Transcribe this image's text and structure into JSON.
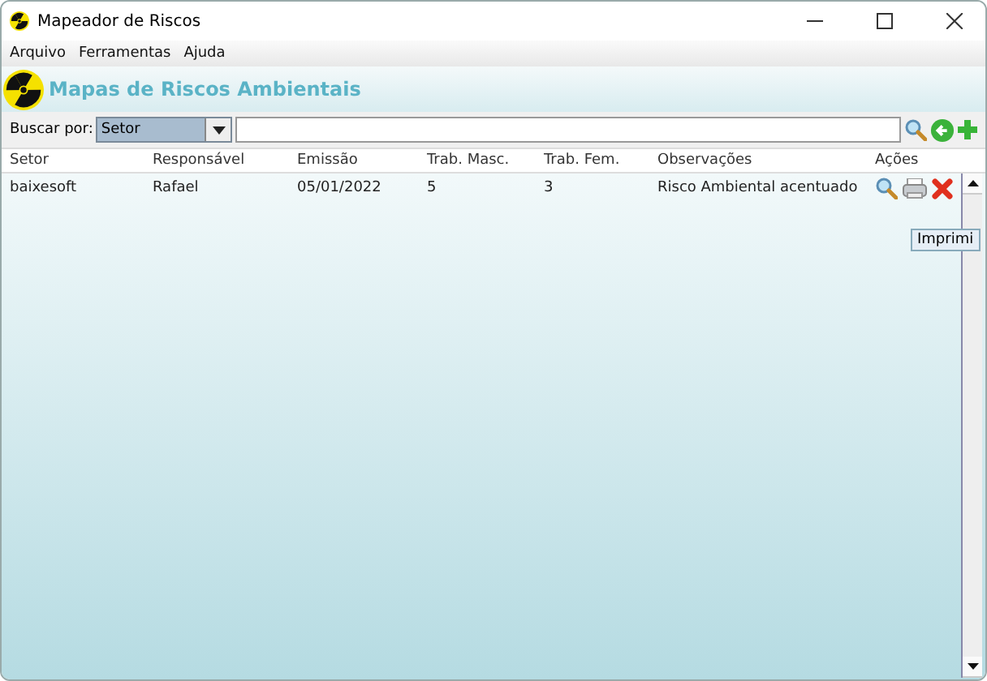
{
  "window": {
    "title": "Mapeador de Riscos"
  },
  "menu": [
    "Arquivo",
    "Ferramentas",
    "Ajuda"
  ],
  "header": {
    "title": "Mapas de Riscos Ambientais"
  },
  "search": {
    "label": "Buscar por:",
    "field": "Setor"
  },
  "table": {
    "columns": [
      "Setor",
      "Responsável",
      "Emissão",
      "Trab. Masc.",
      "Trab. Fem.",
      "Observações",
      "Ações"
    ],
    "rows": [
      {
        "cells": [
          "baixesoft",
          "Rafael",
          "05/01/2022",
          "5",
          "3",
          "Risco Ambiental acentuado"
        ]
      }
    ]
  },
  "tooltip": "Imprimi"
}
